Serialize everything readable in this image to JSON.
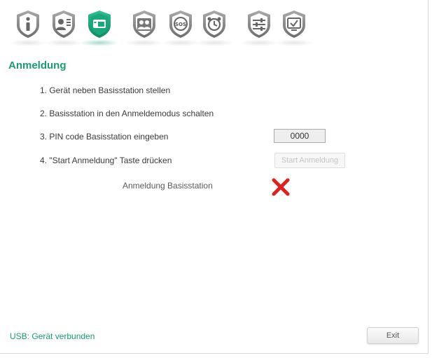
{
  "toolbar": {
    "items": [
      {
        "icon": "info-icon",
        "badge": ""
      },
      {
        "icon": "contacts-icon",
        "badge": ""
      },
      {
        "icon": "phone-registration-icon",
        "badge": "",
        "active": true
      },
      {
        "icon": "people-icon",
        "badge": ""
      },
      {
        "icon": "sos-icon",
        "badge": "SOS"
      },
      {
        "icon": "alarm-clock-icon",
        "badge": ""
      },
      {
        "icon": "settings-sliders-icon",
        "badge": ""
      },
      {
        "icon": "screen-check-icon",
        "badge": ""
      }
    ]
  },
  "section": {
    "title": "Anmeldung",
    "steps": [
      "1. Gerät neben Basisstation stellen",
      "2. Basisstation in den Anmeldemodus schalten",
      "3. PIN code Basisstation eingeben",
      "4. \"Start Anmeldung\" Taste drücken"
    ],
    "pin_value": "0000",
    "start_button": "Start Anmeldung",
    "status_label": "Anmeldung Basisstation",
    "status": "not-registered"
  },
  "footer": {
    "usb_status": "USB: Gerät verbunden",
    "exit_button": "Exit"
  },
  "colors": {
    "accent": "#1b9a74",
    "icon_gray": "#7a7a7a",
    "error_red": "#e0201c"
  }
}
